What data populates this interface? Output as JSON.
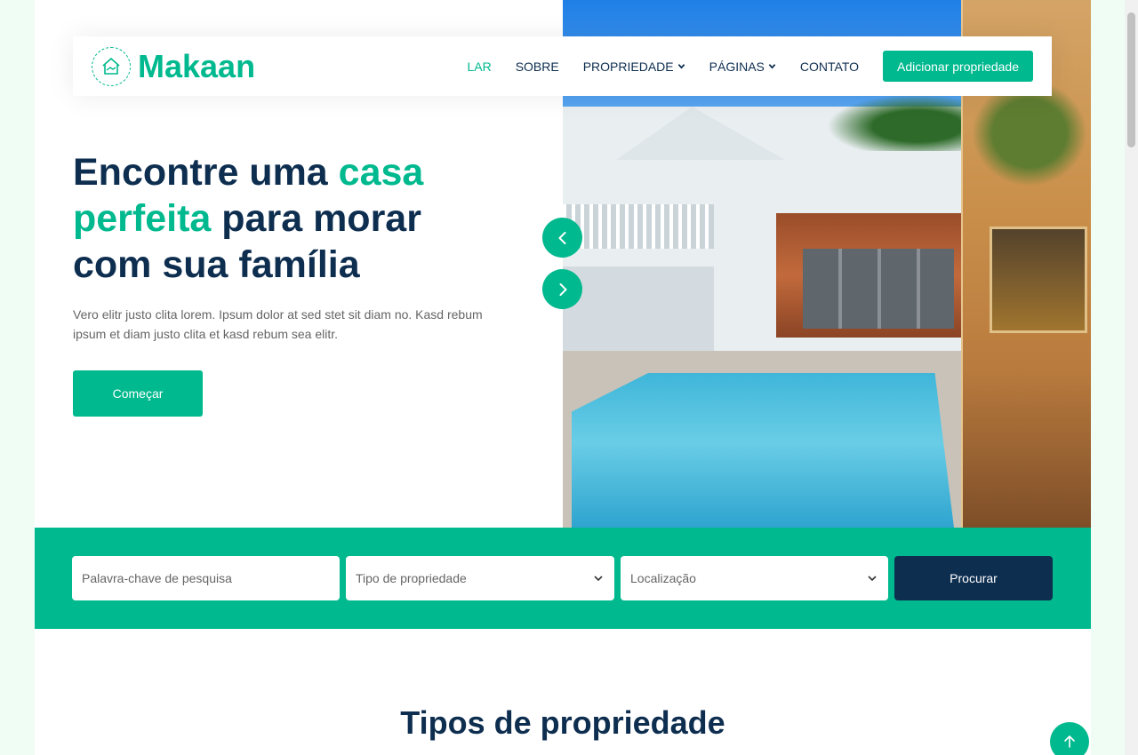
{
  "brand": {
    "name": "Makaan",
    "icon": "house-handshake-icon"
  },
  "nav": {
    "items": [
      {
        "label": "LAR",
        "active": true,
        "dropdown": false
      },
      {
        "label": "SOBRE",
        "active": false,
        "dropdown": false
      },
      {
        "label": "PROPRIEDADE",
        "active": false,
        "dropdown": true
      },
      {
        "label": "PÁGINAS",
        "active": false,
        "dropdown": true
      },
      {
        "label": "CONTATO",
        "active": false,
        "dropdown": false
      }
    ],
    "cta_label": "Adicionar propriedade"
  },
  "hero": {
    "headline_part1": "Encontre uma ",
    "headline_accent": "casa perfeita",
    "headline_part2": " para morar com sua família",
    "lead": "Vero elitr justo clita lorem. Ipsum dolor at sed stet sit diam no. Kasd rebum ipsum et diam justo clita et kasd rebum sea elitr.",
    "button_label": "Começar",
    "image_desc_icon": "house-pool-photo"
  },
  "search": {
    "keyword_placeholder": "Palavra-chave de pesquisa",
    "type_value": "Tipo de propriedade",
    "location_value": "Localização",
    "button_label": "Procurar"
  },
  "section": {
    "title": "Tipos de propriedade"
  },
  "colors": {
    "primary": "#00b98e",
    "dark": "#0e2e50",
    "body_bg": "#effdf5",
    "text_muted": "#666565"
  }
}
